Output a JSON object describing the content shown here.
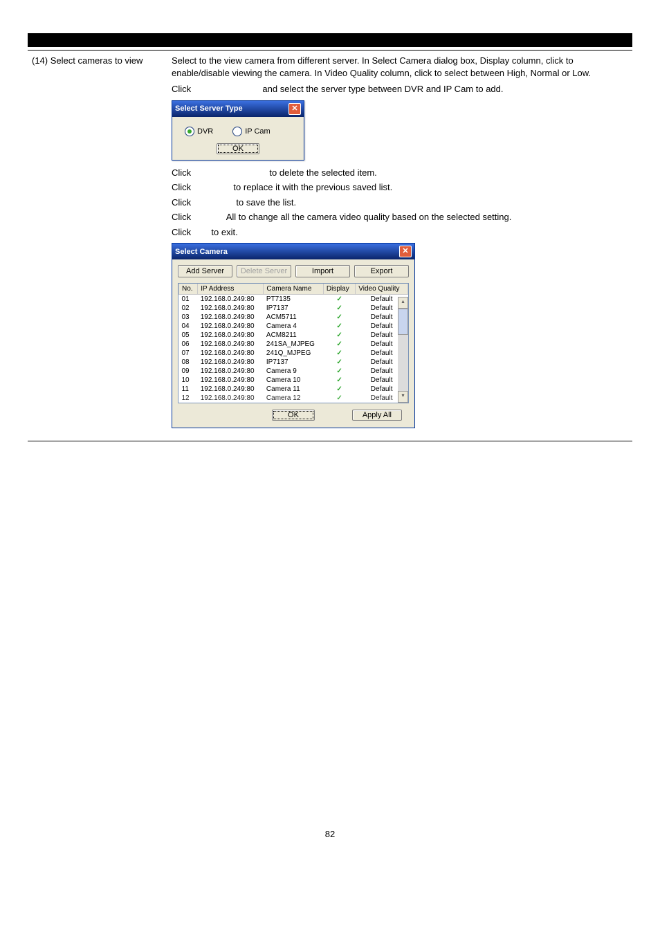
{
  "left": {
    "num": "(14)",
    "title": "Select cameras to view"
  },
  "right": {
    "intro": "Select to the view camera from different server. In Select Camera dialog box, Display column, click to enable/disable viewing the camera. In Video Quality column, click to select between High, Normal or Low.",
    "l1a": "Click",
    "l1b": "and select the server type between DVR and IP Cam to add.",
    "l2a": "Click",
    "l2b": "to delete the selected item.",
    "l3a": "Click",
    "l3b": "to replace it with the previous saved list.",
    "l4a": "Click",
    "l4b": "to save the list.",
    "l5a": "Click",
    "l5b": "All to change all the camera video quality based on the selected setting.",
    "l6a": "Click",
    "l6b": "to exit."
  },
  "dlg_small": {
    "title": "Select Server Type",
    "r1": "DVR",
    "r2": "IP Cam",
    "ok": "OK"
  },
  "dlg_big": {
    "title": "Select Camera",
    "b_add": "Add Server",
    "b_del": "Delete Server",
    "b_imp": "Import",
    "b_exp": "Export",
    "h_no": "No.",
    "h_ip": "IP Address",
    "h_cam": "Camera Name",
    "h_disp": "Display",
    "h_vq": "Video Quality",
    "ok": "OK",
    "apply": "Apply All"
  },
  "chart_data": {
    "type": "table",
    "columns": [
      "No.",
      "IP Address",
      "Camera Name",
      "Display",
      "Video Quality"
    ],
    "rows": [
      {
        "no": "01",
        "ip": "192.168.0.249:80",
        "cam": "PT7135",
        "disp": true,
        "vq": "Default"
      },
      {
        "no": "02",
        "ip": "192.168.0.249:80",
        "cam": "IP7137",
        "disp": true,
        "vq": "Default"
      },
      {
        "no": "03",
        "ip": "192.168.0.249:80",
        "cam": "ACM5711",
        "disp": true,
        "vq": "Default"
      },
      {
        "no": "04",
        "ip": "192.168.0.249:80",
        "cam": "Camera 4",
        "disp": true,
        "vq": "Default"
      },
      {
        "no": "05",
        "ip": "192.168.0.249:80",
        "cam": "ACM8211",
        "disp": true,
        "vq": "Default"
      },
      {
        "no": "06",
        "ip": "192.168.0.249:80",
        "cam": "241SA_MJPEG",
        "disp": true,
        "vq": "Default"
      },
      {
        "no": "07",
        "ip": "192.168.0.249:80",
        "cam": "241Q_MJPEG",
        "disp": true,
        "vq": "Default"
      },
      {
        "no": "08",
        "ip": "192.168.0.249:80",
        "cam": "IP7137",
        "disp": true,
        "vq": "Default"
      },
      {
        "no": "09",
        "ip": "192.168.0.249:80",
        "cam": "Camera 9",
        "disp": true,
        "vq": "Default"
      },
      {
        "no": "10",
        "ip": "192.168.0.249:80",
        "cam": "Camera 10",
        "disp": true,
        "vq": "Default"
      },
      {
        "no": "11",
        "ip": "192.168.0.249:80",
        "cam": "Camera 11",
        "disp": true,
        "vq": "Default"
      },
      {
        "no": "12",
        "ip": "192.168.0.249:80",
        "cam": "Camera 12",
        "disp": true,
        "vq": "Default"
      }
    ]
  },
  "page_number": "82"
}
